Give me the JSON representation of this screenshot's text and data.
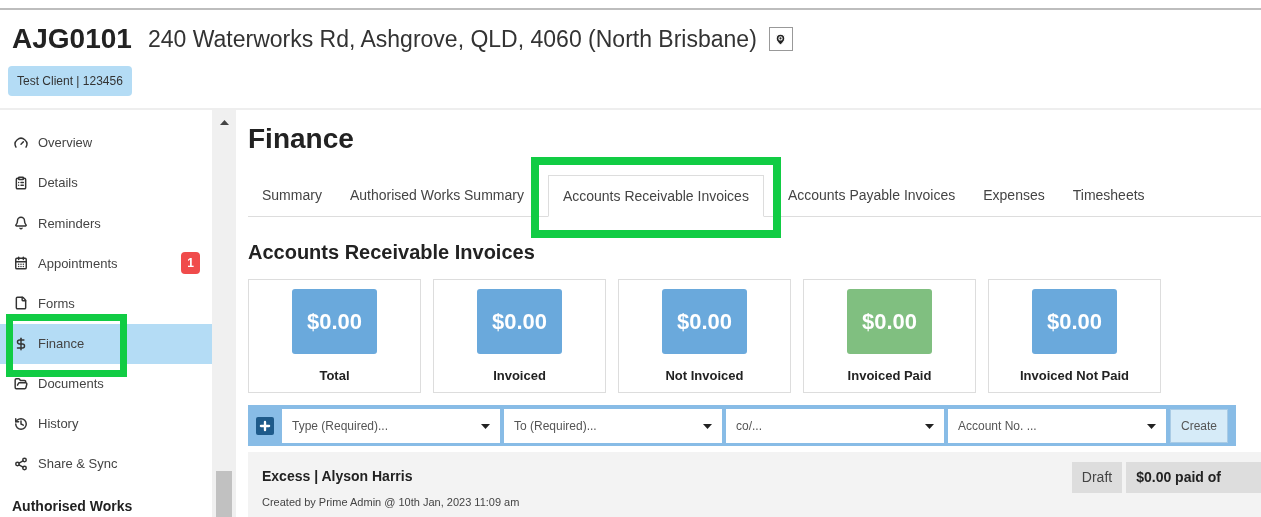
{
  "header": {
    "code": "AJG0101",
    "address": "240 Waterworks Rd, Ashgrove, QLD, 4060 (North Brisbane)",
    "client_tag": "Test Client | 123456"
  },
  "sidebar": {
    "items": [
      {
        "label": "Overview",
        "selected": false,
        "highlighted": false
      },
      {
        "label": "Details",
        "selected": false,
        "highlighted": false
      },
      {
        "label": "Reminders",
        "selected": false,
        "highlighted": false
      },
      {
        "label": "Appointments",
        "badge": "1",
        "selected": false,
        "highlighted": false
      },
      {
        "label": "Forms",
        "selected": false,
        "highlighted": false
      },
      {
        "label": "Finance",
        "selected": true,
        "highlighted": true
      },
      {
        "label": "Documents",
        "selected": false,
        "highlighted": false
      },
      {
        "label": "History",
        "selected": false,
        "highlighted": false
      },
      {
        "label": "Share & Sync",
        "selected": false,
        "highlighted": false
      }
    ],
    "section_heading": "Authorised Works"
  },
  "page_title": "Finance",
  "tabs": [
    {
      "label": "Summary",
      "selected": false,
      "highlighted": false
    },
    {
      "label": "Authorised Works Summary",
      "selected": false,
      "highlighted": false
    },
    {
      "label": "Accounts Receivable Invoices",
      "selected": true,
      "highlighted": true
    },
    {
      "label": "Accounts Payable Invoices",
      "selected": false,
      "highlighted": false
    },
    {
      "label": "Expenses",
      "selected": false,
      "highlighted": false
    },
    {
      "label": "Timesheets",
      "selected": false,
      "highlighted": false
    }
  ],
  "section_title": "Accounts Receivable Invoices",
  "summary_cards": [
    {
      "amount": "$0.00",
      "label": "Total",
      "color": "#6aa9dc"
    },
    {
      "amount": "$0.00",
      "label": "Invoiced",
      "color": "#6aa9dc"
    },
    {
      "amount": "$0.00",
      "label": "Not Invoiced",
      "color": "#6aa9dc"
    },
    {
      "amount": "$0.00",
      "label": "Invoiced Paid",
      "color": "#80bf80"
    },
    {
      "amount": "$0.00",
      "label": "Invoiced Not Paid",
      "color": "#6aa9dc"
    }
  ],
  "create_bar": {
    "fields": [
      {
        "placeholder": "Type (Required)..."
      },
      {
        "placeholder": "To (Required)..."
      },
      {
        "placeholder": "co/..."
      },
      {
        "placeholder": "Account No. ..."
      }
    ],
    "button": "Create"
  },
  "invoices": [
    {
      "title": "Excess | Alyson Harris",
      "meta": "Created by Prime Admin @ 10th Jan, 2023 11:09 am",
      "status": "Draft",
      "paid": "$0.00 paid of"
    }
  ]
}
